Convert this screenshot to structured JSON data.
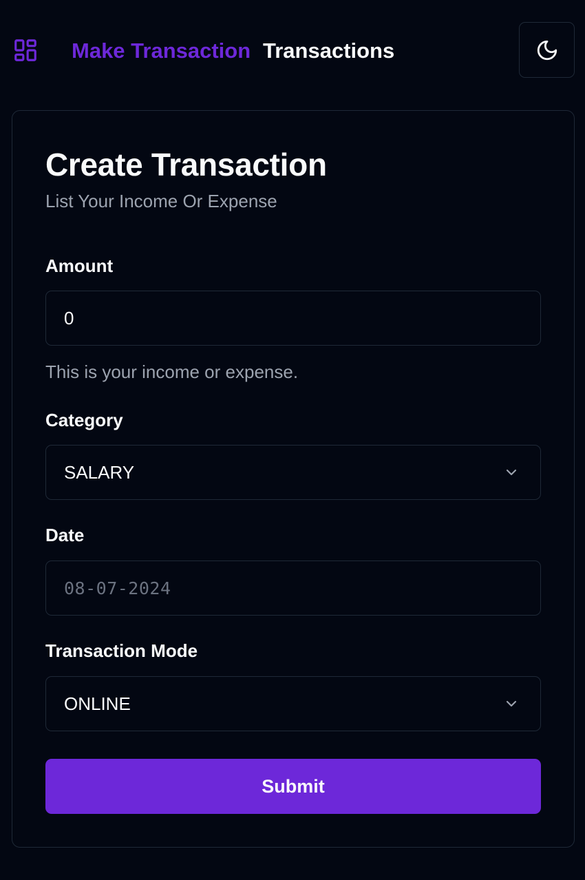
{
  "header": {
    "logo_icon": "layout-grid-icon",
    "nav": [
      {
        "label": "Make Transaction",
        "active": true
      },
      {
        "label": "Transactions",
        "active": false
      }
    ],
    "theme_toggle_icon": "moon-icon"
  },
  "form": {
    "title": "Create Transaction",
    "subtitle": "List Your Income Or Expense",
    "amount": {
      "label": "Amount",
      "value": "0",
      "description": "This is your income or expense."
    },
    "category": {
      "label": "Category",
      "selected": "SALARY",
      "icon": "chevron-down-icon"
    },
    "date": {
      "label": "Date",
      "placeholder": "08-07-2024"
    },
    "transaction_mode": {
      "label": "Transaction Mode",
      "selected": "ONLINE",
      "icon": "chevron-down-icon"
    },
    "submit_label": "Submit"
  },
  "colors": {
    "background": "#030712",
    "accent": "#6d28d9",
    "border": "#1f2937",
    "text": "#f9fafb",
    "muted_text": "#9ca3af"
  }
}
